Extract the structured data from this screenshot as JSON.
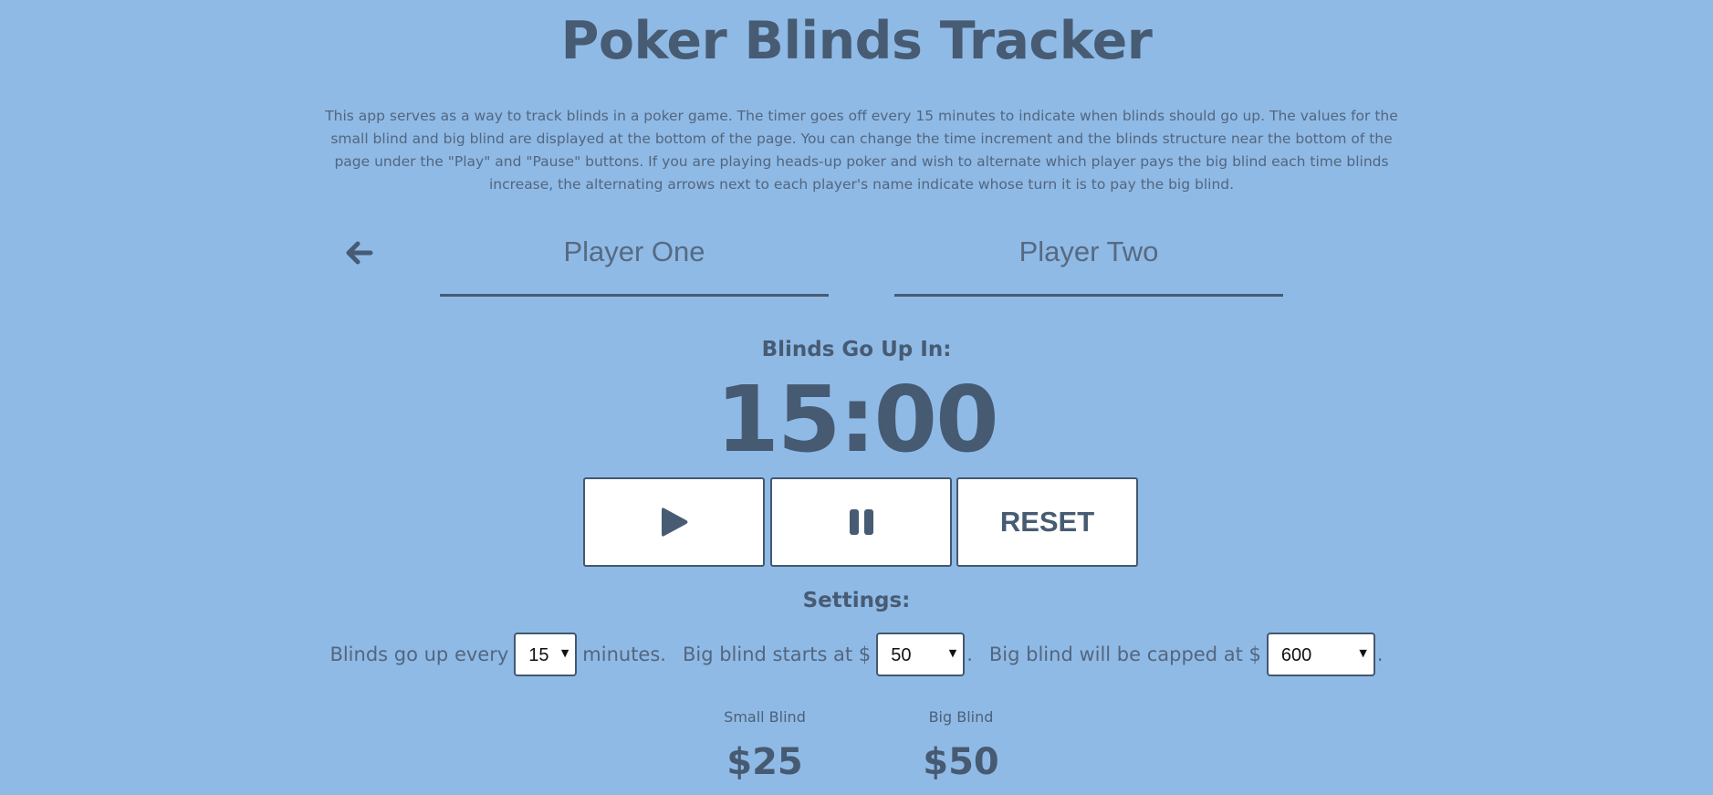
{
  "header": {
    "title": "Poker Blinds Tracker",
    "description": "This app serves as a way to track blinds in a poker game. The timer goes off every 15 minutes to indicate when blinds should go up. The values for the small blind and big blind are displayed at the bottom of the page. You can change the time increment and the blinds structure near the bottom of the page under the \"Play\" and \"Pause\" buttons. If you are playing heads-up poker and wish to alternate which player pays the big blind each time blinds increase, the alternating arrows next to each player's name indicate whose turn it is to pay the big blind."
  },
  "players": {
    "turn_indicator_icon": "arrow-left-icon",
    "player_one": "Player One",
    "player_two": "Player Two"
  },
  "timer": {
    "label": "Blinds Go Up In:",
    "display": "15:00"
  },
  "controls": {
    "play_icon": "play-icon",
    "pause_icon": "pause-icon",
    "reset_label": "RESET"
  },
  "settings": {
    "label": "Settings:",
    "interval_prefix": "Blinds go up every",
    "interval_value": "15",
    "interval_suffix": "minutes.",
    "big_blind_start_prefix": "Big blind starts at $",
    "big_blind_start_value": "50",
    "big_blind_cap_prefix": "Big blind will be capped at $",
    "big_blind_cap_value": "600",
    "period": "."
  },
  "blinds": {
    "small_label": "Small Blind",
    "small_value": "$25",
    "big_label": "Big Blind",
    "big_value": "$50"
  },
  "colors": {
    "background": "#8fbae6",
    "text": "#475b73",
    "button_bg": "#ffffff"
  }
}
